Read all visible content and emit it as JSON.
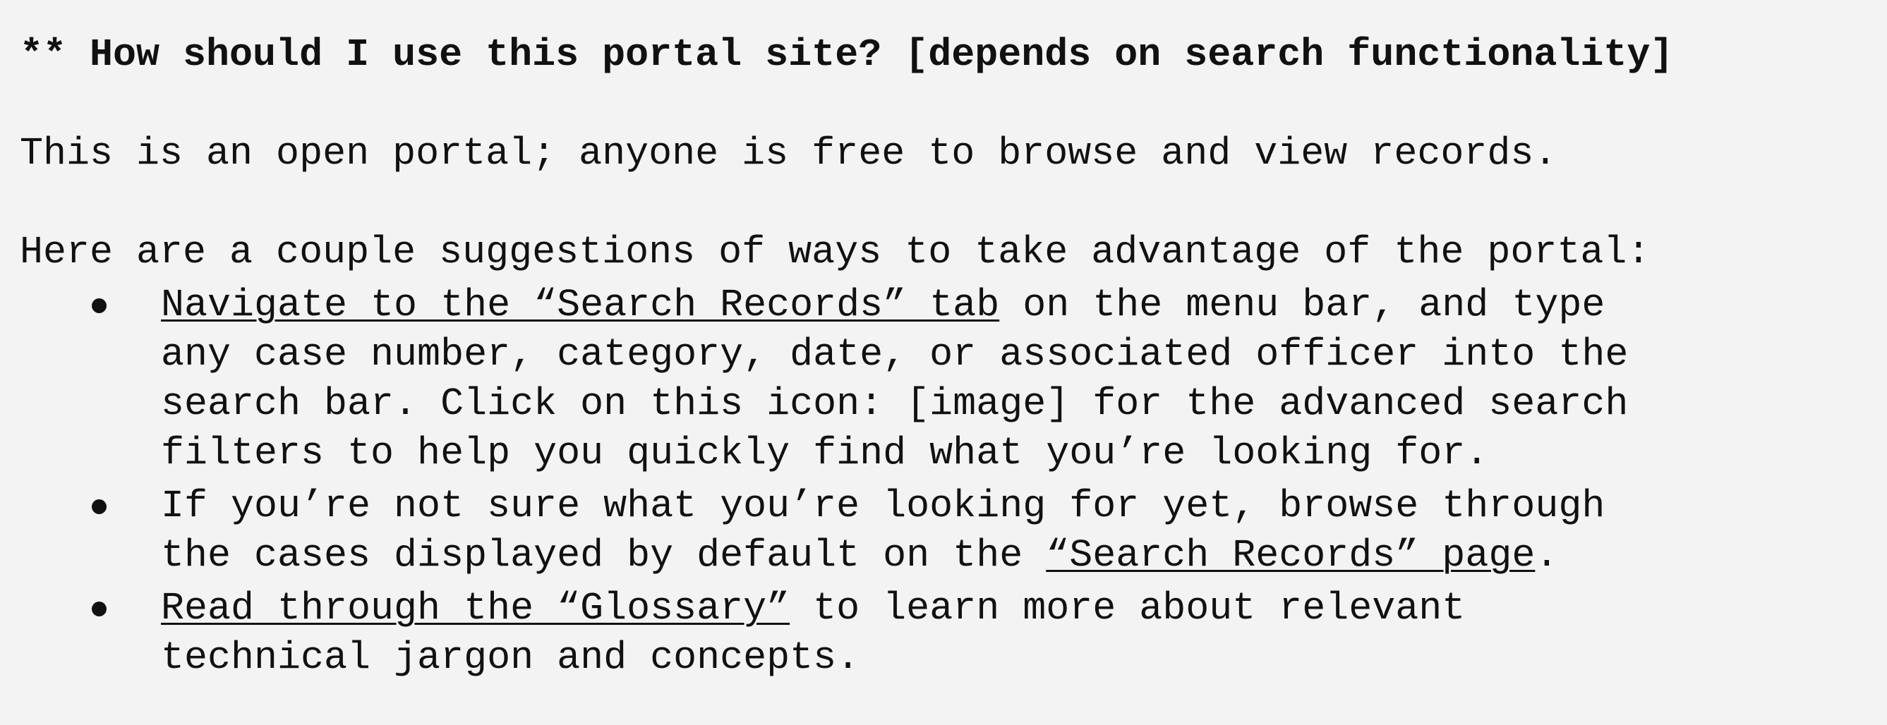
{
  "heading": "** How should I use this portal site? [depends on search functionality]",
  "intro": "This is an open portal; anyone is free to browse and view records.",
  "lead": "Here are a couple suggestions of ways to take advantage of the portal:",
  "bullets": [
    {
      "link_text": "Navigate to the “Search Records” tab",
      "line1_rest": " on the menu bar, and type",
      "line2": "any case number, category, date, or associated officer into the",
      "line3": "search bar. Click on this icon: [image] for the advanced search",
      "line4": "filters to help you quickly find what you’re looking for."
    },
    {
      "line1": "If you’re not sure what you’re looking for yet, browse through",
      "line2_pre": "the cases displayed by default on the ",
      "link_text": "“Search Records” page",
      "line2_post": "."
    },
    {
      "link_text": "Read through the “Glossary”",
      "line1_rest": " to learn more about relevant",
      "line2": "technical jargon and concepts."
    }
  ]
}
